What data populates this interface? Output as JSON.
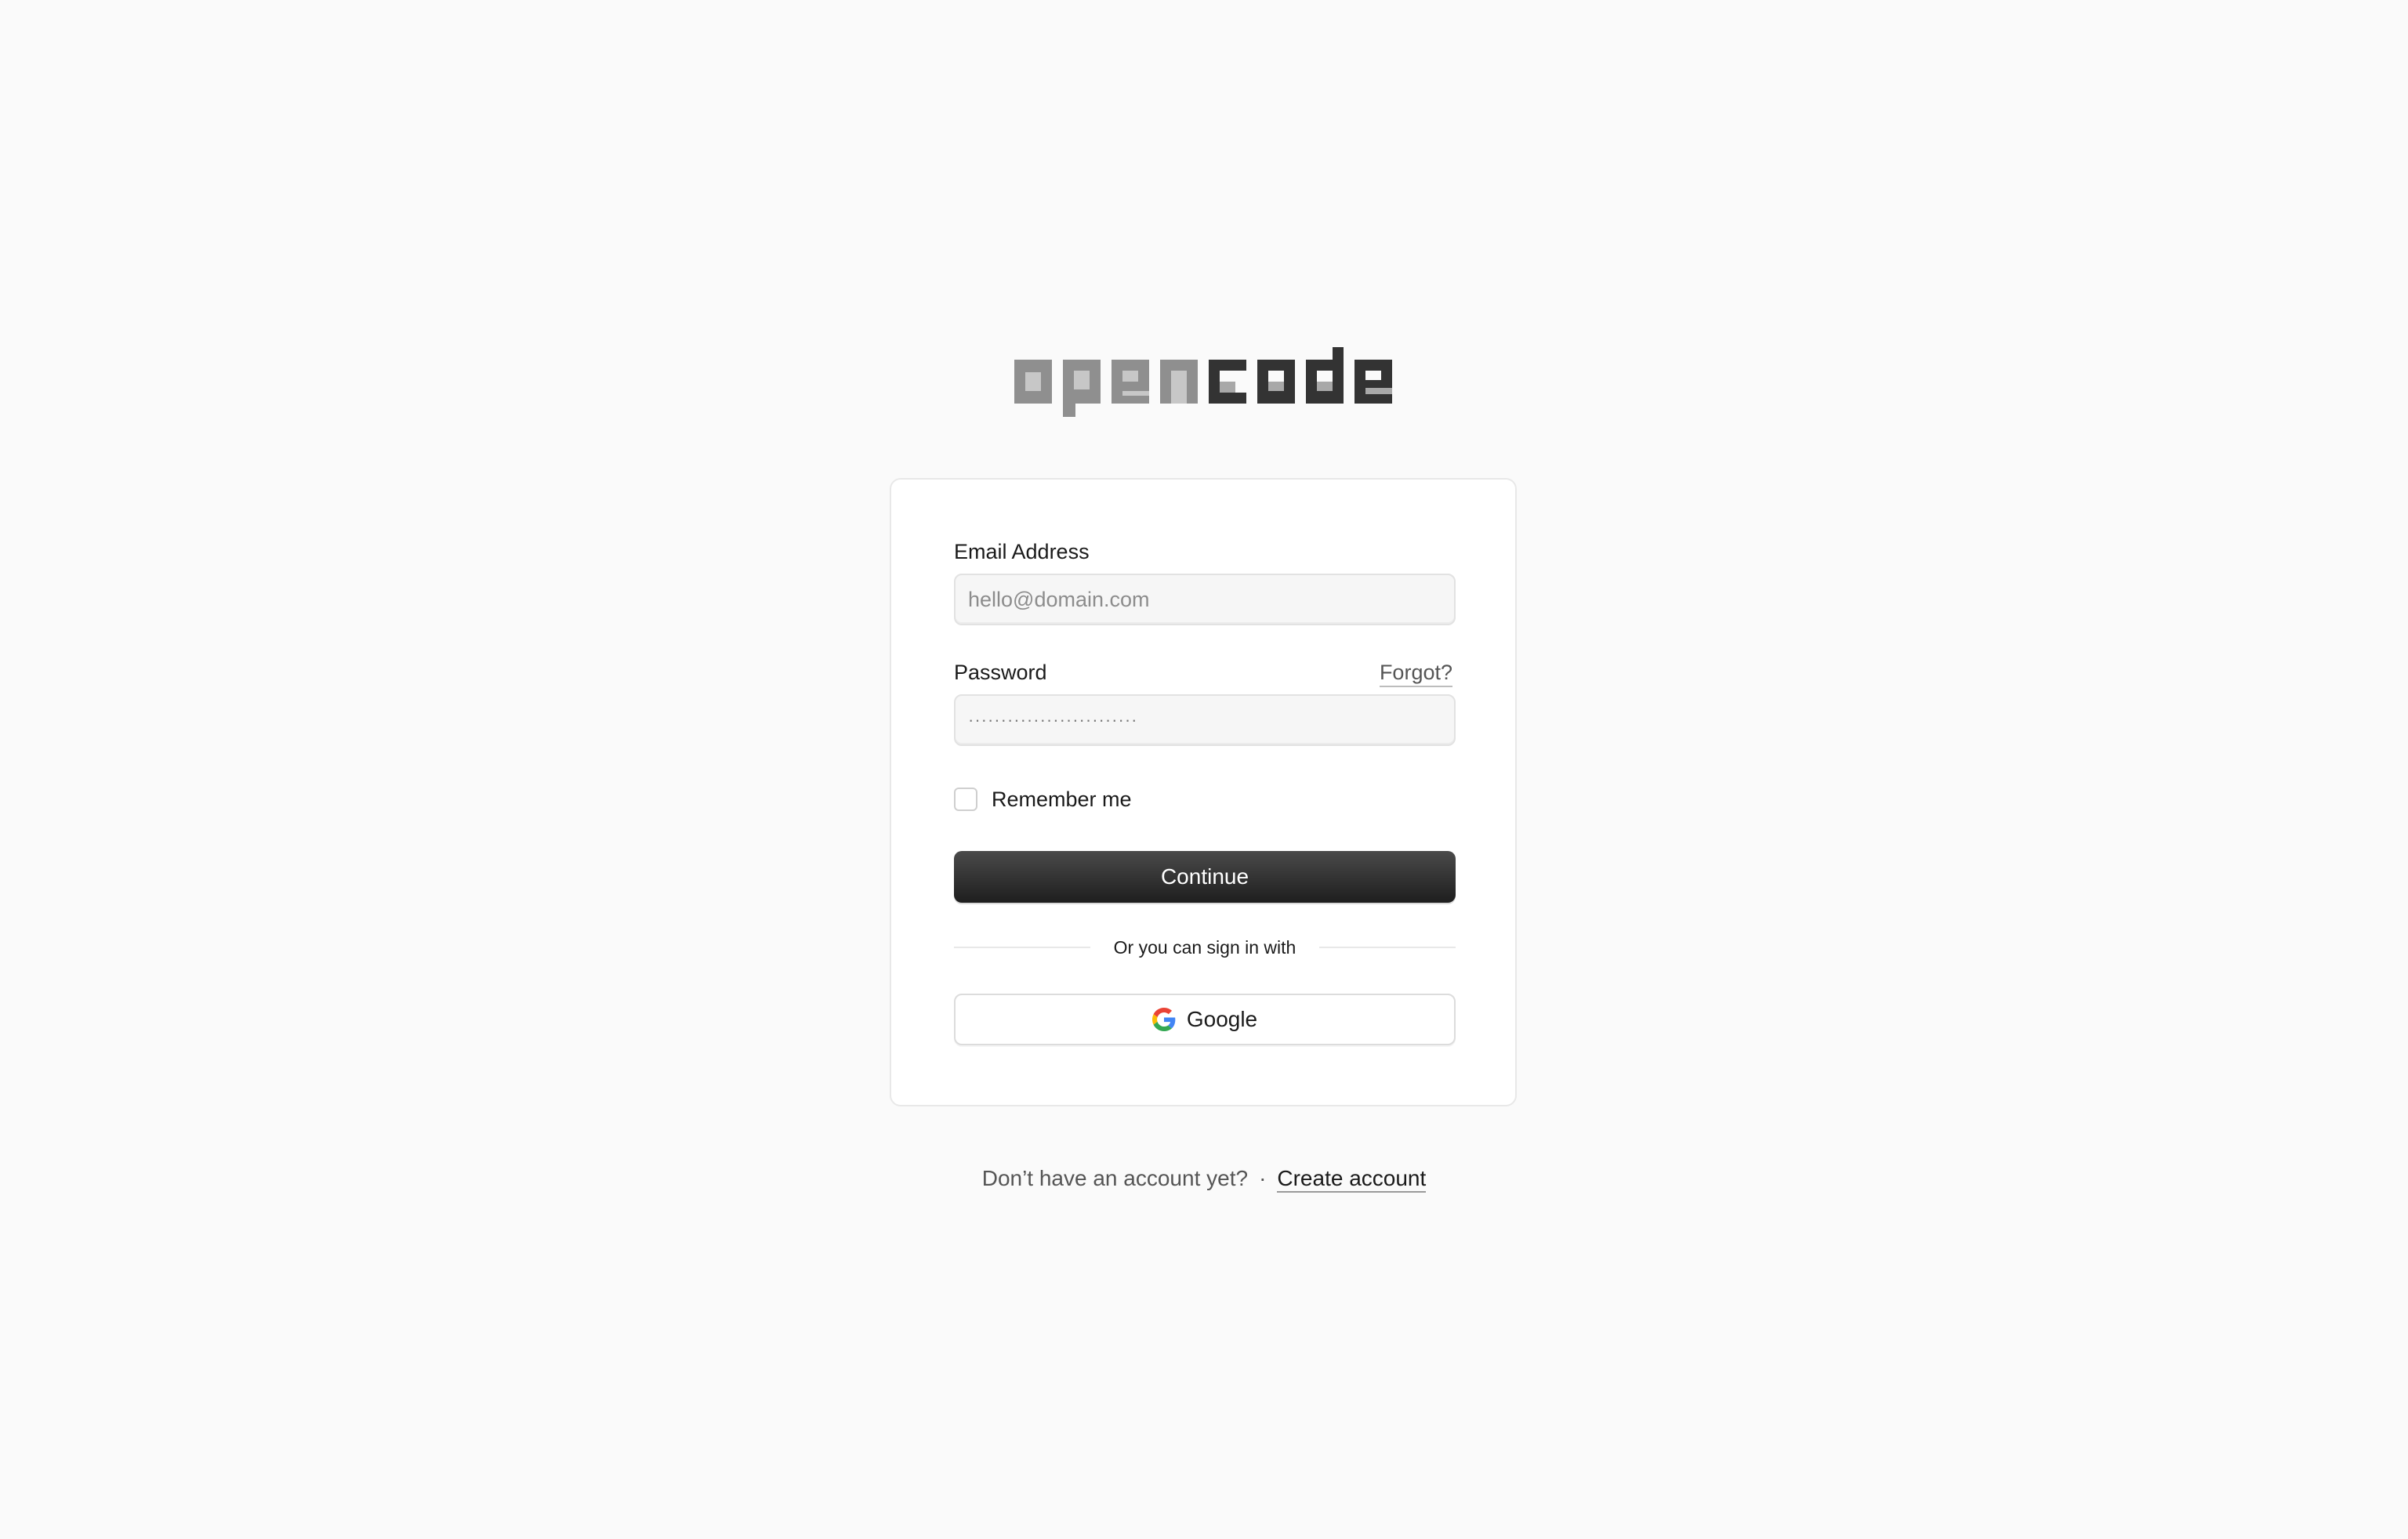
{
  "brand": {
    "logo_part_light": "open",
    "logo_part_dark": "code",
    "colors": {
      "light_outer": "#8f8f8f",
      "light_inner": "#c7c7c7",
      "dark_outer": "#333333",
      "dark_inner": "#a8a8a8"
    }
  },
  "login_form": {
    "email_label": "Email Address",
    "email_placeholder": "hello@domain.com",
    "email_value": "",
    "password_label": "Password",
    "forgot_label": "Forgot?",
    "password_value": "··························",
    "remember_label": "Remember me",
    "remember_checked": false,
    "continue_label": "Continue",
    "divider_text": "Or you can sign in with",
    "google_label": "Google",
    "google_icon": "google-icon"
  },
  "footer": {
    "prompt": "Don’t have an account yet?",
    "separator": "·",
    "create_label": "Create account"
  }
}
